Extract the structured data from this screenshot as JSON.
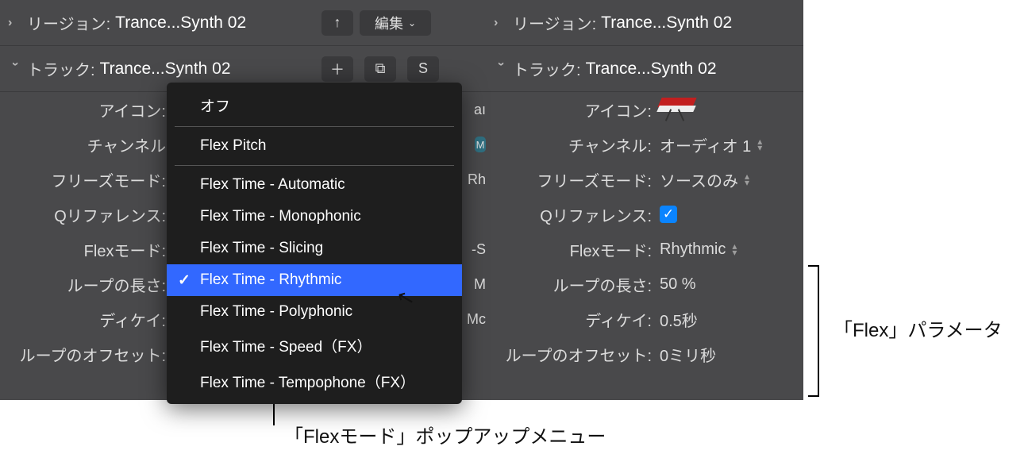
{
  "left": {
    "region": {
      "label": "リージョン:",
      "value": "Trance...Synth 02"
    },
    "track": {
      "label": "トラック:",
      "value": "Trance...Synth 02"
    },
    "rows": [
      {
        "label": "アイコン:"
      },
      {
        "label": "チャンネル"
      },
      {
        "label": "フリーズモード:"
      },
      {
        "label": "Qリファレンス:"
      },
      {
        "label": "Flexモード:"
      },
      {
        "label": "ループの長さ:"
      },
      {
        "label": "ディケイ:"
      },
      {
        "label": "ループのオフセット:"
      }
    ]
  },
  "right": {
    "region": {
      "label": "リージョン:",
      "value": "Trance...Synth 02"
    },
    "track": {
      "label": "トラック:",
      "value": "Trance...Synth 02"
    },
    "props": {
      "icon": {
        "label": "アイコン:"
      },
      "channel": {
        "label": "チャンネル:",
        "value": "オーディオ 1"
      },
      "freeze": {
        "label": "フリーズモード:",
        "value": "ソースのみ"
      },
      "qref": {
        "label": "Qリファレンス:",
        "checked": true
      },
      "flexmode": {
        "label": "Flexモード:",
        "value": "Rhythmic"
      },
      "looplen": {
        "label": "ループの長さ:",
        "value": "50 %"
      },
      "decay": {
        "label": "ディケイ:",
        "value": "0.5秒"
      },
      "loopoff": {
        "label": "ループのオフセット:",
        "value": "0ミリ秒"
      }
    }
  },
  "toolbar": {
    "edit_label": "編集",
    "s_label": "S",
    "peek1": "aı",
    "peek2": "M",
    "peek3": "Rh",
    "peek4": "-S",
    "peek5": "M",
    "peek6": "Mc"
  },
  "popup": {
    "items": [
      {
        "text": "オフ",
        "group": 0
      },
      {
        "text": "Flex Pitch",
        "group": 1
      },
      {
        "text": "Flex Time - Automatic",
        "group": 2
      },
      {
        "text": "Flex Time - Monophonic",
        "group": 2
      },
      {
        "text": "Flex Time - Slicing",
        "group": 2
      },
      {
        "text": "Flex Time - Rhythmic",
        "group": 2,
        "selected": true
      },
      {
        "text": "Flex Time - Polyphonic",
        "group": 2
      },
      {
        "text": "Flex Time - Speed（FX）",
        "group": 2
      },
      {
        "text": "Flex Time - Tempophone（FX）",
        "group": 2
      }
    ]
  },
  "callouts": {
    "flex_params": "「Flex」パラメータ",
    "flex_popup": "「Flexモード」ポップアップメニュー"
  }
}
